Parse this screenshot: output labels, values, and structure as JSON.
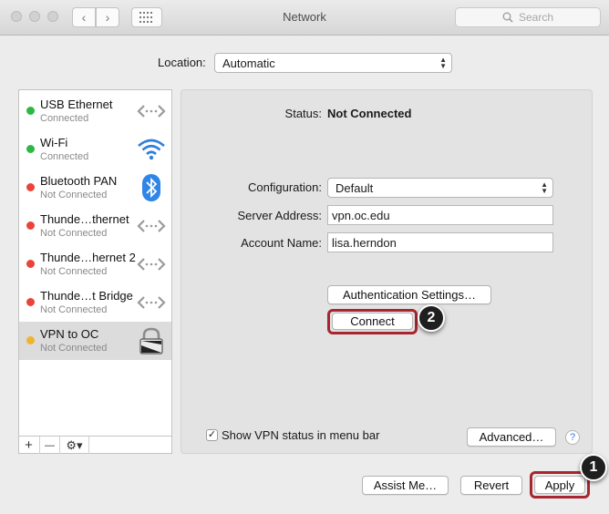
{
  "window": {
    "title": "Network"
  },
  "search": {
    "placeholder": "Search"
  },
  "location": {
    "label": "Location:",
    "value": "Automatic"
  },
  "services": [
    {
      "name": "USB Ethernet",
      "status": "Connected",
      "dot": "#2db845",
      "icon": "ethernet-arrows-icon"
    },
    {
      "name": "Wi-Fi",
      "status": "Connected",
      "dot": "#2db845",
      "icon": "wifi-icon"
    },
    {
      "name": "Bluetooth PAN",
      "status": "Not Connected",
      "dot": "#e8443a",
      "icon": "bluetooth-icon"
    },
    {
      "name": "Thunde…thernet",
      "status": "Not Connected",
      "dot": "#e8443a",
      "icon": "ethernet-arrows-icon"
    },
    {
      "name": "Thunde…hernet 2",
      "status": "Not Connected",
      "dot": "#e8443a",
      "icon": "ethernet-arrows-icon"
    },
    {
      "name": "Thunde…t Bridge",
      "status": "Not Connected",
      "dot": "#e8443a",
      "icon": "ethernet-arrows-icon"
    },
    {
      "name": "VPN to OC",
      "status": "Not Connected",
      "dot": "#f0b429",
      "icon": "vpn-lock-icon",
      "selected": true
    }
  ],
  "sidebar_buttons": {
    "add": "+",
    "remove": "—"
  },
  "detail": {
    "status_label": "Status:",
    "status_value": "Not Connected",
    "configuration_label": "Configuration:",
    "configuration_value": "Default",
    "server_label": "Server Address:",
    "server_value": "vpn.oc.edu",
    "account_label": "Account Name:",
    "account_value": "lisa.herndon",
    "auth_button": "Authentication Settings…",
    "connect_button": "Connect",
    "show_status_label": "Show VPN status in menu bar",
    "show_status_checked": true,
    "advanced_button": "Advanced…",
    "help": "?"
  },
  "footer": {
    "assist": "Assist Me…",
    "revert": "Revert",
    "apply": "Apply"
  },
  "markers": {
    "one": "1",
    "two": "2"
  },
  "colors": {
    "highlight": "#a8262f",
    "connected": "#2db845",
    "disconnected": "#e8443a",
    "vpn": "#f0b429"
  }
}
